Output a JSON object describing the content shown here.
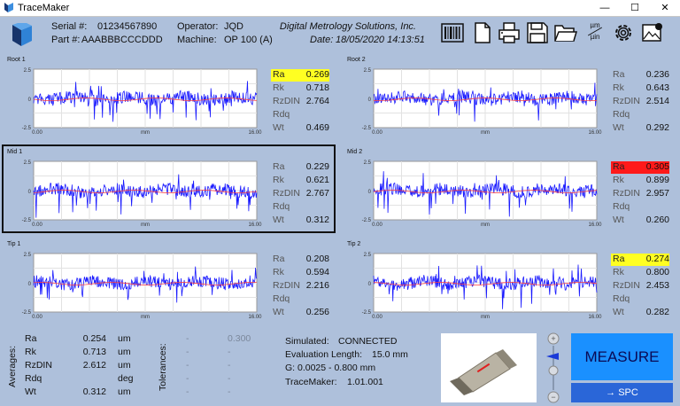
{
  "window": {
    "title": "TraceMaker",
    "minimize": "—",
    "maximize": "☐",
    "close": "✕"
  },
  "header": {
    "serial_label": "Serial #:",
    "serial": "01234567890",
    "part_label": "Part #:",
    "part": "AAABBBCCCDDD",
    "operator_label": "Operator:",
    "operator": "JQD",
    "machine_label": "Machine:",
    "machine": "OP 100 (A)",
    "company": "Digital Metrology Solutions, Inc.",
    "date_label": "Date:",
    "date": "18/05/2020  14:13:51"
  },
  "toolbar": {
    "icons": [
      "barcode-icon",
      "new-document-icon",
      "printer-icon",
      "save-icon",
      "open-folder-icon",
      "units-icon",
      "settings-icon",
      "image-export-icon"
    ],
    "units_label_top": "µm",
    "units_label_bottom": "µin"
  },
  "plot_axis": {
    "ymax": "2.5",
    "ymid": "0",
    "ymin": "-2.5",
    "xmin": "0.00",
    "xunit": "mm",
    "xmax": "16.00"
  },
  "panels": [
    {
      "name": "Root 1",
      "stats": [
        {
          "label": "Ra",
          "value": "0.269",
          "highlight": "yellow"
        },
        {
          "label": "Rk",
          "value": "0.718"
        },
        {
          "label": "RzDIN",
          "value": "2.764"
        },
        {
          "label": "Rdq",
          "value": ""
        },
        {
          "label": "Wt",
          "value": "0.469"
        }
      ]
    },
    {
      "name": "Root 2",
      "stats": [
        {
          "label": "Ra",
          "value": "0.236"
        },
        {
          "label": "Rk",
          "value": "0.643"
        },
        {
          "label": "RzDIN",
          "value": "2.514"
        },
        {
          "label": "Rdq",
          "value": ""
        },
        {
          "label": "Wt",
          "value": "0.292"
        }
      ]
    },
    {
      "name": "Mid 1",
      "stats": [
        {
          "label": "Ra",
          "value": "0.229"
        },
        {
          "label": "Rk",
          "value": "0.621"
        },
        {
          "label": "RzDIN",
          "value": "2.767"
        },
        {
          "label": "Rdq",
          "value": ""
        },
        {
          "label": "Wt",
          "value": "0.312"
        }
      ]
    },
    {
      "name": "Mid 2",
      "stats": [
        {
          "label": "Ra",
          "value": "0.305",
          "highlight": "red"
        },
        {
          "label": "Rk",
          "value": "0.899"
        },
        {
          "label": "RzDIN",
          "value": "2.957"
        },
        {
          "label": "Rdq",
          "value": ""
        },
        {
          "label": "Wt",
          "value": "0.260"
        }
      ]
    },
    {
      "name": "Tip 1",
      "stats": [
        {
          "label": "Ra",
          "value": "0.208"
        },
        {
          "label": "Rk",
          "value": "0.594"
        },
        {
          "label": "RzDIN",
          "value": "2.216"
        },
        {
          "label": "Rdq",
          "value": ""
        },
        {
          "label": "Wt",
          "value": "0.256"
        }
      ]
    },
    {
      "name": "Tip 2",
      "stats": [
        {
          "label": "Ra",
          "value": "0.274",
          "highlight": "yellow"
        },
        {
          "label": "Rk",
          "value": "0.800"
        },
        {
          "label": "RzDIN",
          "value": "2.453"
        },
        {
          "label": "Rdq",
          "value": ""
        },
        {
          "label": "Wt",
          "value": "0.282"
        }
      ]
    }
  ],
  "averages": {
    "title": "Averages:",
    "rows": [
      {
        "label": "Ra",
        "value": "0.254",
        "unit": "um"
      },
      {
        "label": "Rk",
        "value": "0.713",
        "unit": "um"
      },
      {
        "label": "RzDIN",
        "value": "2.612",
        "unit": "um"
      },
      {
        "label": "Rdq",
        "value": "",
        "unit": "deg"
      },
      {
        "label": "Wt",
        "value": "0.312",
        "unit": "um"
      }
    ]
  },
  "tolerances": {
    "title": "Tolerances:",
    "rows": [
      {
        "low": "-",
        "high": "0.300"
      },
      {
        "low": "-",
        "high": "-"
      },
      {
        "low": "-",
        "high": "-"
      },
      {
        "low": "-",
        "high": "-"
      },
      {
        "low": "-",
        "high": "-"
      }
    ]
  },
  "status": {
    "simulated_label": "Simulated:",
    "simulated": "CONNECTED",
    "eval_label": "Evaluation Length:",
    "eval": "15.0 mm",
    "g_label": "G:",
    "g": "0.0025 - 0.800 mm",
    "version_label": "TraceMaker:",
    "version": "1.01.001"
  },
  "buttons": {
    "measure": "MEASURE",
    "spc": "→ SPC"
  },
  "colors": {
    "trace": "#1a1aff",
    "mean": "#ff4040",
    "highlight_yellow": "#ffff22",
    "highlight_red": "#ff1a1a",
    "measure": "#1a90ff",
    "spc": "#2a66d8"
  }
}
